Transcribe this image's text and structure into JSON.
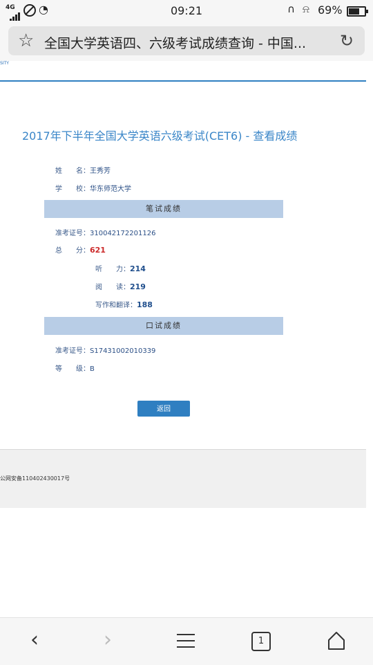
{
  "status_bar": {
    "network": "4G",
    "time": "09:21",
    "battery_percent": "69%"
  },
  "url_bar": {
    "title": "全国大学英语四、六级考试成绩查询 - 中国..."
  },
  "page": {
    "top_fragment": "SITY",
    "title": "2017年下半年全国大学英语六级考试(CET6) - 查看成绩",
    "name_label": "姓　　名：",
    "name_value": "王秀芳",
    "school_label": "学　　校：",
    "school_value": "华东师范大学",
    "written_section": "笔试成绩",
    "ticket_label": "准考证号：",
    "ticket_value": "310042172201126",
    "total_label": "总　　分：",
    "total_value": "621",
    "listening_label": "听　　力：",
    "listening_value": "214",
    "reading_label": "阅　　读：",
    "reading_value": "219",
    "writing_label": "写作和翻译：",
    "writing_value": "188",
    "oral_section": "口试成绩",
    "oral_ticket_label": "准考证号：",
    "oral_ticket_value": "S17431002010339",
    "grade_label": "等　　级：",
    "grade_value": "B",
    "back_button": "返回",
    "footer_text": "公网安备110402430017号"
  },
  "bottom_nav": {
    "tab_count": "1"
  },
  "colors": {
    "accent": "#2f7fc1",
    "band": "#b8cde6",
    "total_score": "#cc2a2a"
  }
}
